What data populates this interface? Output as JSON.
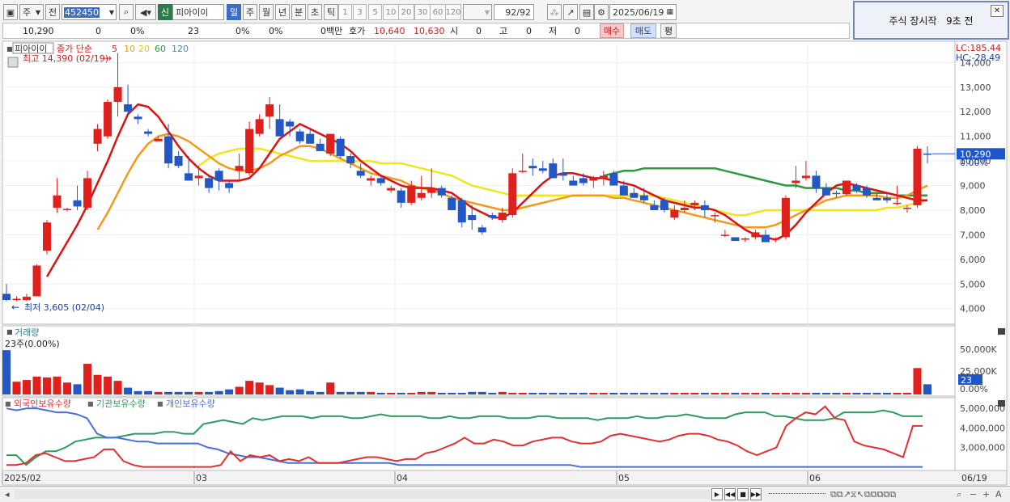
{
  "toolbar": {
    "period_label": "주",
    "prev_label": "전",
    "code": "452450",
    "badge": "신",
    "name": "피아이이",
    "periods": [
      "일",
      "주",
      "월",
      "년",
      "분",
      "초",
      "틱"
    ],
    "active_period": "일",
    "nums": [
      "1",
      "3",
      "5",
      "10",
      "20",
      "30",
      "60",
      "120"
    ],
    "count": "92/92",
    "date": "2025/06/19"
  },
  "notice": {
    "text": "주식 장시작   9초 전"
  },
  "quote": {
    "price": "10,290",
    "change": "0",
    "change_pct": "0%",
    "volume": "23",
    "v1": "0%",
    "v2": "0%",
    "amount": "0백만",
    "hoga_label": "호가",
    "ask": "10,640",
    "bid": "10,630",
    "open_label": "시",
    "open": "0",
    "high_label": "고",
    "high": "0",
    "low_label": "저",
    "low": "0",
    "buy_label": "매수",
    "sell_label": "매도",
    "eval_label": "평"
  },
  "price_panel": {
    "stock_tag": "피아이이",
    "ma_label": "종가 단순",
    "ma_periods": [
      "5",
      "10",
      "20",
      "60",
      "120"
    ],
    "ma_colors": [
      "#dd1111",
      "#ff9900",
      "#e6c800",
      "#2e9a3e",
      "#3b87c8"
    ],
    "high_note": "최고 14,390 (02/19)",
    "low_note": "최저 3,605 (02/04)",
    "lc": "LC:185.44",
    "hc": "HC:-28.49",
    "current": "10,290",
    "pct0": "0.00%",
    "y_ticks": [
      "14,000",
      "13,000",
      "12,000",
      "11,000",
      "10,000",
      "9,000",
      "8,000",
      "7,000",
      "6,000",
      "5,000",
      "4,000"
    ]
  },
  "volume_panel": {
    "title": "거래량",
    "sub": "23주(0.00%)",
    "current": "23",
    "y_ticks": [
      "50,000K",
      "25,000K",
      "0.00%"
    ]
  },
  "holder_panel": {
    "legend": [
      "외국인보유수량",
      "기관보유수량",
      "개인보유수량"
    ],
    "colors": [
      "#e03030",
      "#2e9a5e",
      "#4a6fd8"
    ],
    "y_ticks": [
      "5,000,000",
      "4,000,000",
      "3,000,000"
    ]
  },
  "x_axis": {
    "labels": [
      "2025/02",
      "03",
      "04",
      "05",
      "06"
    ],
    "end_label": "06/19"
  },
  "chart_data": {
    "type": "candlestick",
    "x_labels": [
      "2025/02",
      "03",
      "04",
      "05",
      "06"
    ],
    "ylim": [
      3400,
      14800
    ],
    "candles": [
      [
        4600,
        5000,
        4300,
        4350
      ],
      [
        4400,
        4500,
        4300,
        4400
      ],
      [
        4350,
        4600,
        4300,
        4480
      ],
      [
        4500,
        5800,
        4500,
        5750
      ],
      [
        6350,
        7600,
        6200,
        7500
      ],
      [
        8100,
        9300,
        7900,
        8600
      ],
      [
        8000,
        8100,
        7950,
        8050
      ],
      [
        8400,
        9000,
        8000,
        8150
      ],
      [
        8100,
        9600,
        8000,
        9300
      ],
      [
        10700,
        11500,
        10400,
        11300
      ],
      [
        11000,
        12500,
        10900,
        12400
      ],
      [
        12400,
        14390,
        11800,
        13000
      ],
      [
        12300,
        13100,
        11800,
        12000
      ],
      [
        11800,
        11900,
        11500,
        11700
      ],
      [
        11200,
        11300,
        11000,
        11100
      ],
      [
        10800,
        11000,
        10900,
        10900
      ],
      [
        11000,
        11500,
        9700,
        9900
      ],
      [
        10200,
        10400,
        9700,
        9800
      ],
      [
        9500,
        10200,
        9300,
        9200
      ],
      [
        9300,
        9800,
        9000,
        9400
      ],
      [
        9300,
        9400,
        8700,
        8900
      ],
      [
        9600,
        9700,
        8800,
        9200
      ],
      [
        9100,
        9200,
        8700,
        8900
      ],
      [
        9600,
        10300,
        9200,
        9800
      ],
      [
        9500,
        11600,
        9400,
        11300
      ],
      [
        11100,
        11900,
        11000,
        11700
      ],
      [
        11800,
        12600,
        11300,
        12300
      ],
      [
        11700,
        12300,
        11200,
        11000
      ],
      [
        11600,
        11700,
        11000,
        11400
      ],
      [
        11200,
        11300,
        10700,
        10800
      ],
      [
        11100,
        11300,
        10800,
        10700
      ],
      [
        10700,
        10900,
        10400,
        10400
      ],
      [
        10300,
        11100,
        10200,
        11100
      ],
      [
        10900,
        11000,
        10100,
        10200
      ],
      [
        10200,
        10300,
        9700,
        9900
      ],
      [
        9600,
        9900,
        9300,
        9400
      ],
      [
        9200,
        9400,
        9000,
        9300
      ],
      [
        9300,
        9400,
        9000,
        9100
      ],
      [
        8800,
        9000,
        8700,
        8900
      ],
      [
        8800,
        8900,
        8100,
        8300
      ],
      [
        8300,
        9200,
        8200,
        9000
      ],
      [
        8500,
        9400,
        8400,
        8700
      ],
      [
        8700,
        9700,
        8500,
        8900
      ],
      [
        8900,
        9000,
        8500,
        8600
      ],
      [
        8500,
        8600,
        8000,
        8000
      ],
      [
        8400,
        8500,
        7300,
        7500
      ],
      [
        7800,
        8200,
        7200,
        7600
      ],
      [
        7300,
        7400,
        7000,
        7100
      ],
      [
        7800,
        7900,
        7600,
        7700
      ],
      [
        7600,
        8100,
        7500,
        7900
      ],
      [
        7800,
        9700,
        7700,
        9500
      ],
      [
        9600,
        10300,
        9500,
        9600
      ],
      [
        9800,
        10100,
        9400,
        9700
      ],
      [
        9700,
        10000,
        9500,
        9600
      ],
      [
        9900,
        10100,
        9500,
        9300
      ],
      [
        9500,
        10100,
        9200,
        9400
      ],
      [
        9200,
        9400,
        9000,
        9000
      ],
      [
        9300,
        9500,
        9000,
        9100
      ],
      [
        9200,
        9400,
        8900,
        9300
      ],
      [
        9300,
        9600,
        9000,
        9400
      ],
      [
        9500,
        9600,
        9200,
        9000
      ],
      [
        9000,
        9200,
        8800,
        8600
      ],
      [
        8700,
        8900,
        8500,
        8500
      ],
      [
        8600,
        8900,
        8300,
        8400
      ],
      [
        8200,
        8400,
        8000,
        8000
      ],
      [
        8400,
        8500,
        7900,
        8000
      ],
      [
        7700,
        8200,
        7600,
        8000
      ],
      [
        8000,
        8400,
        7900,
        8100
      ],
      [
        8200,
        8400,
        8000,
        8300
      ],
      [
        8200,
        8400,
        7700,
        8000
      ],
      [
        7800,
        7900,
        7500,
        7800
      ],
      [
        7000,
        7200,
        6900,
        7000
      ],
      [
        6900,
        6900,
        6750,
        6750
      ],
      [
        6800,
        6900,
        6700,
        6850
      ],
      [
        6900,
        7200,
        6800,
        7100
      ],
      [
        7000,
        7200,
        6700,
        6700
      ],
      [
        6800,
        6900,
        6700,
        6850
      ],
      [
        6900,
        8600,
        6800,
        8500
      ],
      [
        9100,
        9800,
        8900,
        9200
      ],
      [
        9300,
        10000,
        9200,
        9400
      ],
      [
        9400,
        9600,
        8700,
        8900
      ],
      [
        8900,
        9100,
        8600,
        8600
      ],
      [
        8700,
        8800,
        8500,
        8650
      ],
      [
        8650,
        9200,
        8600,
        9200
      ],
      [
        9000,
        9100,
        8700,
        8800
      ],
      [
        8900,
        9000,
        8500,
        8600
      ],
      [
        8500,
        8700,
        8400,
        8400
      ],
      [
        8500,
        8700,
        8300,
        8400
      ],
      [
        8300,
        9000,
        8200,
        8300
      ],
      [
        8100,
        8200,
        7900,
        8100
      ],
      [
        8200,
        10600,
        8100,
        10500
      ],
      [
        10300,
        10600,
        9900,
        10290
      ]
    ],
    "ma5": [
      null,
      null,
      null,
      null,
      5300,
      6000,
      6700,
      7400,
      8200,
      9100,
      10000,
      11000,
      11900,
      12300,
      12200,
      11800,
      11200,
      10600,
      10100,
      9700,
      9400,
      9200,
      9200,
      9200,
      9300,
      9700,
      10300,
      10900,
      11200,
      11500,
      11300,
      11100,
      10900,
      10700,
      10400,
      10000,
      9700,
      9400,
      9200,
      9000,
      8900,
      8900,
      8900,
      8800,
      8700,
      8400,
      8100,
      7900,
      7700,
      7700,
      7900,
      8300,
      8700,
      9100,
      9400,
      9500,
      9500,
      9400,
      9300,
      9300,
      9200,
      9100,
      9000,
      8800,
      8600,
      8400,
      8300,
      8200,
      8100,
      8100,
      8000,
      7800,
      7500,
      7200,
      7000,
      6900,
      6800,
      7000,
      7400,
      7900,
      8300,
      8700,
      9000,
      9100,
      9000,
      8900,
      8800,
      8700,
      8600,
      8500,
      8400,
      8400
    ],
    "ma10": [
      null,
      null,
      null,
      null,
      null,
      null,
      null,
      null,
      null,
      7200,
      7900,
      8700,
      9500,
      10200,
      10700,
      11000,
      11100,
      11000,
      10800,
      10500,
      10200,
      9900,
      9700,
      9600,
      9600,
      9700,
      9900,
      10200,
      10400,
      10600,
      10600,
      10500,
      10300,
      10100,
      9900,
      9700,
      9500,
      9400,
      9300,
      9200,
      9000,
      8900,
      8800,
      8700,
      8500,
      8400,
      8300,
      8200,
      8100,
      8000,
      8000,
      8100,
      8200,
      8300,
      8400,
      8500,
      8600,
      8600,
      8600,
      8600,
      8500,
      8500,
      8400,
      8300,
      8200,
      8100,
      8000,
      7900,
      7800,
      7700,
      7600,
      7500,
      7400,
      7300,
      7300,
      7300,
      7400,
      7600,
      7800,
      8000,
      8200,
      8400,
      8500,
      8600,
      8600,
      8600,
      8600,
      8500,
      8500,
      8600,
      8800,
      9000
    ],
    "ma20": [
      null,
      null,
      null,
      null,
      null,
      null,
      null,
      null,
      null,
      null,
      null,
      null,
      null,
      null,
      null,
      null,
      null,
      null,
      null,
      9800,
      10100,
      10300,
      10400,
      10500,
      10500,
      10500,
      10400,
      10300,
      10200,
      10100,
      10000,
      10000,
      10000,
      10000,
      10000,
      10000,
      10000,
      9900,
      9900,
      9900,
      9800,
      9700,
      9600,
      9500,
      9400,
      9200,
      9000,
      8900,
      8800,
      8700,
      8600,
      8600,
      8600,
      8600,
      8600,
      8600,
      8600,
      8600,
      8600,
      8600,
      8600,
      8600,
      8600,
      8600,
      8600,
      8500,
      8400,
      8300,
      8200,
      8100,
      8000,
      7900,
      7800,
      7800,
      7900,
      8000,
      8000,
      8000,
      8000,
      8000,
      8000,
      8000,
      8000,
      8000,
      8000,
      8000,
      8000,
      8100,
      8100,
      8200,
      8300,
      8400
    ],
    "ma60": [
      null,
      null,
      null,
      null,
      null,
      null,
      null,
      null,
      null,
      null,
      null,
      null,
      null,
      null,
      null,
      null,
      null,
      null,
      null,
      null,
      null,
      null,
      null,
      null,
      null,
      null,
      null,
      null,
      null,
      null,
      null,
      null,
      null,
      null,
      null,
      null,
      null,
      null,
      null,
      null,
      null,
      null,
      null,
      null,
      null,
      null,
      null,
      null,
      null,
      null,
      null,
      null,
      null,
      null,
      null,
      null,
      null,
      null,
      null,
      9400,
      9500,
      9600,
      9600,
      9700,
      9700,
      9700,
      9700,
      9700,
      9700,
      9700,
      9700,
      9600,
      9500,
      9400,
      9300,
      9200,
      9100,
      9000,
      9000,
      8900,
      8900,
      8900,
      8900,
      8800,
      8800,
      8700,
      8700,
      8700,
      8600,
      8600,
      8600,
      8600
    ],
    "volume_k": [
      52000,
      15000,
      17000,
      21000,
      20000,
      21000,
      14000,
      12000,
      36000,
      23000,
      21000,
      16000,
      8000,
      4000,
      4000,
      3000,
      3000,
      3000,
      3000,
      3000,
      3000,
      4000,
      6000,
      9000,
      16000,
      14000,
      11000,
      8000,
      5000,
      6000,
      4000,
      3000,
      14000,
      3000,
      3000,
      3000,
      3000,
      2000,
      2000,
      2000,
      2000,
      3000,
      3000,
      2000,
      2000,
      2000,
      3000,
      3000,
      2000,
      3000,
      2000,
      2000,
      2000,
      2000,
      2000,
      2000,
      2000,
      2000,
      2000,
      2000,
      2000,
      2000,
      2000,
      2000,
      2000,
      2000,
      2000,
      2000,
      2000,
      2000,
      2000,
      2000,
      2000,
      2000,
      2000,
      2000,
      2000,
      2000,
      2000,
      2000,
      2000,
      2000,
      2000,
      2000,
      2000,
      2000,
      2000,
      2000,
      2000,
      2000,
      31000,
      12000
    ],
    "foreign": [
      2100000,
      2100000,
      2200000,
      2600000,
      2700000,
      2500000,
      2300000,
      2300000,
      2400000,
      2500000,
      2900000,
      2900000,
      2300000,
      2100000,
      2000000,
      2000000,
      2000000,
      2000000,
      2000000,
      2000000,
      2000000,
      2000000,
      2100000,
      2800000,
      2300000,
      2600000,
      2500000,
      2600000,
      2300000,
      2400000,
      2300000,
      2500000,
      2200000,
      2200000,
      2200000,
      2300000,
      2400000,
      2500000,
      2500000,
      2400000,
      2300000,
      2400000,
      2400000,
      2700000,
      2800000,
      3000000,
      3200000,
      3500000,
      3200000,
      3200000,
      3400000,
      3300000,
      3100000,
      3100000,
      3300000,
      3400000,
      3500000,
      3500000,
      3300000,
      3200000,
      3200000,
      3300000,
      3600000,
      3700000,
      3600000,
      3500000,
      3400000,
      3300000,
      3400000,
      3600000,
      3700000,
      3700000,
      3600000,
      3400000,
      3300000,
      3100000,
      2800000,
      2600000,
      2800000,
      3000000,
      4100000,
      4500000,
      4800000,
      4700000,
      5100000,
      4500000,
      4400000,
      3300000,
      3100000,
      3000000,
      2900000,
      2700000,
      2500000,
      4100000,
      4100000
    ],
    "institution": [
      2600000,
      2600000,
      2100000,
      2500000,
      2800000,
      2800000,
      3000000,
      3300000,
      3400000,
      3500000,
      3500000,
      3500000,
      3600000,
      3700000,
      3700000,
      3700000,
      3800000,
      3800000,
      3700000,
      3700000,
      4200000,
      4300000,
      4400000,
      4300000,
      4200000,
      4500000,
      4400000,
      4500000,
      4600000,
      4600000,
      4600000,
      4500000,
      4600000,
      4600000,
      4600000,
      4500000,
      4500000,
      4600000,
      4700000,
      4600000,
      4600000,
      4600000,
      4600000,
      4500000,
      4500000,
      4600000,
      4500000,
      4500000,
      4600000,
      4600000,
      4600000,
      4500000,
      4500000,
      4500000,
      4600000,
      4600000,
      4500000,
      4500000,
      4500000,
      4500000,
      4400000,
      4500000,
      4500000,
      4500000,
      4600000,
      4500000,
      4500000,
      4600000,
      4600000,
      4700000,
      4600000,
      4500000,
      4500000,
      4500000,
      4700000,
      4800000,
      4800000,
      4800000,
      4600000,
      4600000,
      4500000,
      4400000,
      4400000,
      4400000,
      4500000,
      4800000,
      4800000,
      4800000,
      4800000,
      4900000,
      4800000,
      4600000,
      4600000,
      4600000
    ],
    "individual": [
      5000000,
      4900000,
      5000000,
      5000000,
      4900000,
      4800000,
      4800000,
      4700000,
      4500000,
      3700000,
      3500000,
      3500000,
      3400000,
      3300000,
      3300000,
      3200000,
      3200000,
      3200000,
      3200000,
      3200000,
      3000000,
      2900000,
      2700000,
      2600000,
      2500000,
      2500000,
      2400000,
      2300000,
      2200000,
      2200000,
      2200000,
      2200000,
      2200000,
      2200000,
      2200000,
      2200000,
      2200000,
      2200000,
      2200000,
      2100000,
      2100000,
      2100000,
      2100000,
      2100000,
      2100000,
      2100000,
      2100000,
      2100000,
      2100000,
      2100000,
      2100000,
      2100000,
      2100000,
      2100000,
      2100000,
      2100000,
      2100000,
      2000000,
      2000000,
      2000000,
      2000000,
      2000000,
      2000000,
      2000000,
      2000000,
      2000000,
      2000000,
      2000000,
      2000000,
      2000000,
      2000000,
      2000000,
      2000000,
      2000000,
      2000000,
      2000000,
      2000000,
      2000000,
      2000000,
      2000000,
      2000000,
      2000000,
      2000000,
      2000000,
      2000000,
      2000000,
      2000000,
      2000000,
      2000000,
      2000000,
      2000000,
      2000000
    ]
  }
}
